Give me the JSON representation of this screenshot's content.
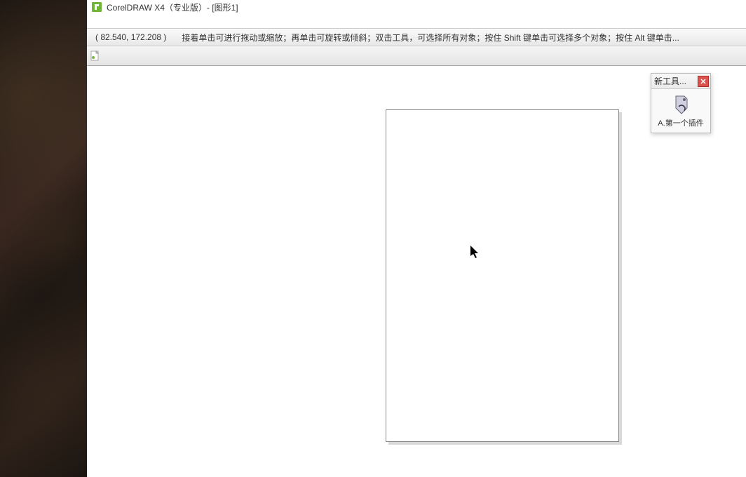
{
  "app": {
    "title": "CorelDRAW X4（专业版）- [图形1]"
  },
  "status": {
    "coordinates": "( 82.540, 172.208 )",
    "hint": "接着单击可进行拖动或缩放；再单击可旋转或倾斜；双击工具，可选择所有对象；按住 Shift 键单击可选择多个对象；按住 Alt 键单击..."
  },
  "docker": {
    "title": "新工具...",
    "plugin_label": "A.第一个插件"
  }
}
